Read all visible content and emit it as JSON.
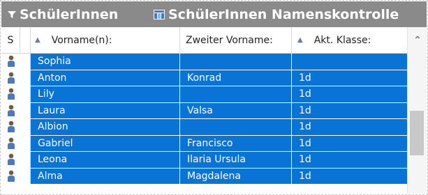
{
  "tabs": [
    {
      "label": "SchülerInnen",
      "icon": "filter-icon"
    },
    {
      "label": "SchülerInnen Namenskontrolle",
      "icon": "table-icon"
    }
  ],
  "columns": {
    "status": "S",
    "vorname": "Vorname(n):",
    "zweiter_vorname": "Zweiter Vorname:",
    "klasse": "Akt. Klasse:"
  },
  "rows": [
    {
      "vorname": "Sophia",
      "zweiter_vorname": "",
      "klasse": ""
    },
    {
      "vorname": "Anton",
      "zweiter_vorname": "Konrad",
      "klasse": "1d"
    },
    {
      "vorname": "Lily",
      "zweiter_vorname": "",
      "klasse": "1d"
    },
    {
      "vorname": "Laura",
      "zweiter_vorname": "Valsa",
      "klasse": "1d"
    },
    {
      "vorname": "Albion",
      "zweiter_vorname": "",
      "klasse": "1d"
    },
    {
      "vorname": "Gabriel",
      "zweiter_vorname": "Francisco",
      "klasse": "1d"
    },
    {
      "vorname": "Leona",
      "zweiter_vorname": "Ilaria Ursula",
      "klasse": "1d"
    },
    {
      "vorname": "Alma",
      "zweiter_vorname": "Magdalena",
      "klasse": "1d"
    }
  ],
  "colors": {
    "header_bg": "#8a8a8a",
    "selection": "#0a74d6",
    "user_icon_body": "#4a7bc0",
    "user_icon_head": "#7a5a3a"
  }
}
